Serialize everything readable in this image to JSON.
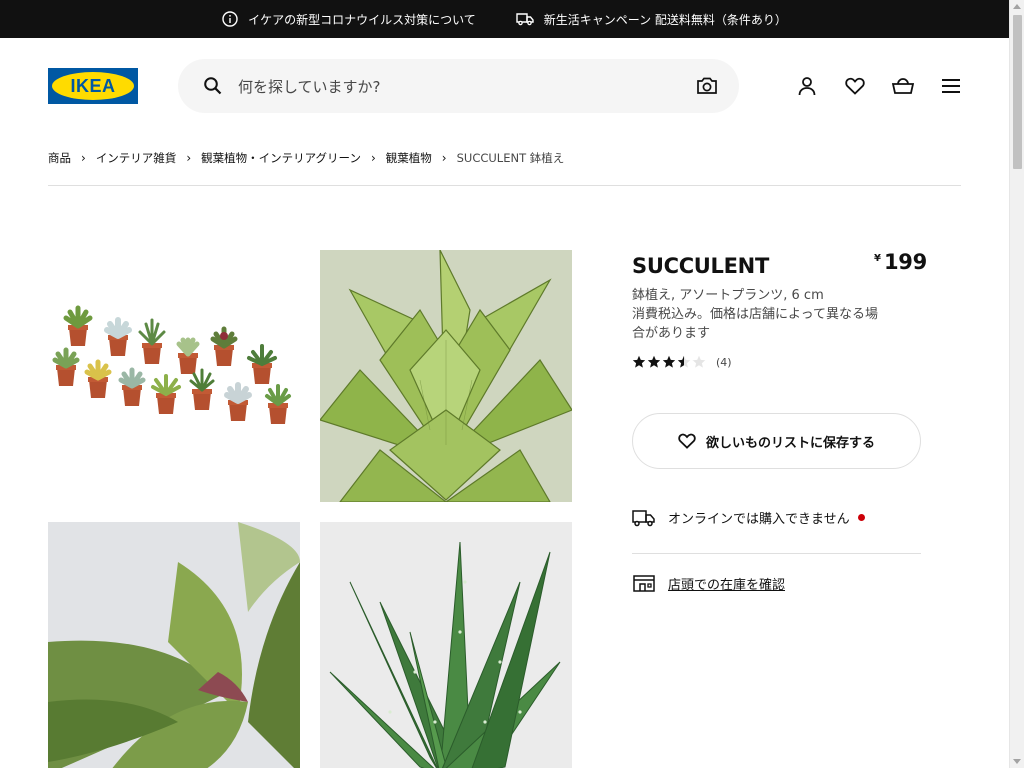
{
  "topbar": {
    "covid_notice": "イケアの新型コロナウイルス対策について",
    "campaign": "新生活キャンペーン 配送料無料（条件あり）"
  },
  "header": {
    "logo_text": "IKEA",
    "search_placeholder": "何を探していますか?",
    "icons": [
      "profile-icon",
      "heart-icon",
      "cart-icon",
      "menu-icon"
    ]
  },
  "breadcrumb": {
    "items": [
      "商品",
      "インテリア雑貨",
      "観葉植物・インテリアグリーン",
      "観葉植物"
    ],
    "current": "SUCCULENT 鉢植え"
  },
  "product": {
    "name": "SUCCULENT",
    "currency": "¥",
    "price": "199",
    "desc_line1": "鉢植え, アソートプランツ, 6 cm",
    "desc_line2": "消費税込み。価格は店舗によって異なる場合があります",
    "rating_value": 3.5,
    "rating_max": 5,
    "rating_count": "(4)",
    "wishlist_label": "欲しいものリストに保存する",
    "availability": "オンラインでは購入できません",
    "store_stock": "店頭での在庫を確認"
  },
  "colors": {
    "topbar_bg": "#111111",
    "ikea_blue": "#0058a3",
    "ikea_yellow": "#ffdb00",
    "unavailable_dot": "#cc0008"
  }
}
